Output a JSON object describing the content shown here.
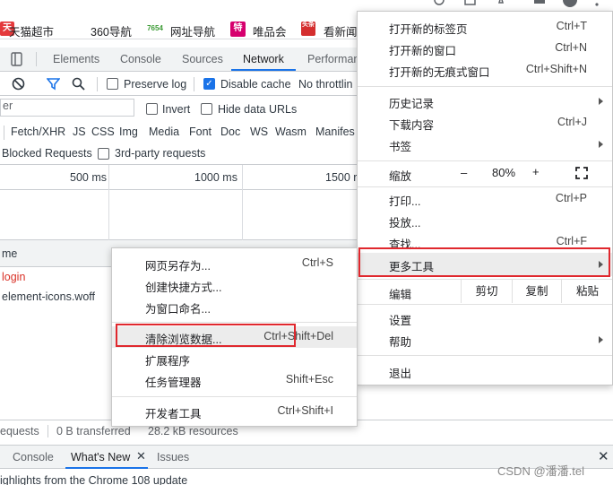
{
  "bookmarks": [
    {
      "icon": "天",
      "label": "天猫超市",
      "color": "#e4393c"
    },
    {
      "icon": "",
      "label": "360导航",
      "color": "#ffffff"
    },
    {
      "icon": "7654",
      "label": "网址导航",
      "color": "#ffffff"
    },
    {
      "icon": "特",
      "label": "唯品会",
      "color": "#d6006e"
    },
    {
      "icon": "头条",
      "label": "看新闻",
      "color": "#d42e2e"
    }
  ],
  "devtools": {
    "tabs": [
      "Elements",
      "Console",
      "Sources",
      "Network",
      "Performan"
    ],
    "active_tab": "Network",
    "preserve_log": "Preserve log",
    "disable_cache": "Disable cache",
    "throttling": "No throttlin",
    "filter_value": "er",
    "invert": "Invert",
    "hide_data_urls": "Hide data URLs",
    "types": [
      "Fetch/XHR",
      "JS",
      "CSS",
      "Img",
      "Media",
      "Font",
      "Doc",
      "WS",
      "Wasm",
      "Manifes"
    ],
    "blocked_requests": "Blocked Requests",
    "third_party": "3rd-party requests",
    "ticks": [
      "500 ms",
      "1000 ms",
      "1500 r"
    ],
    "name_header": "me",
    "requests": [
      {
        "name": "login",
        "color": "#d93025"
      },
      {
        "name": "element-icons.woff",
        "color": "#303942"
      }
    ],
    "status": [
      "equests",
      "0 B transferred",
      "28.2 kB resources"
    ],
    "drawer_tabs": [
      "Console",
      "What's New",
      "Issues"
    ],
    "drawer_text": "ighlights from the Chrome 108 update"
  },
  "context_menu": {
    "items": [
      {
        "label": "网页另存为...",
        "shortcut": "Ctrl+S"
      },
      {
        "label": "创建快捷方式...",
        "shortcut": ""
      },
      {
        "label": "为窗口命名...",
        "shortcut": ""
      },
      {
        "label": "清除浏览数据...",
        "shortcut": "Ctrl+Shift+Del"
      },
      {
        "label": "扩展程序",
        "shortcut": ""
      },
      {
        "label": "任务管理器",
        "shortcut": "Shift+Esc"
      },
      {
        "label": "开发者工具",
        "shortcut": "Ctrl+Shift+I"
      }
    ]
  },
  "chrome_menu": {
    "new_tab": {
      "label": "打开新的标签页",
      "shortcut": "Ctrl+T"
    },
    "new_window": {
      "label": "打开新的窗口",
      "shortcut": "Ctrl+N"
    },
    "incognito": {
      "label": "打开新的无痕式窗口",
      "shortcut": "Ctrl+Shift+N"
    },
    "history": {
      "label": "历史记录"
    },
    "downloads": {
      "label": "下载内容",
      "shortcut": "Ctrl+J"
    },
    "bookmarks": {
      "label": "书签"
    },
    "zoom": {
      "label": "缩放",
      "minus": "–",
      "value": "80%",
      "plus": "+"
    },
    "print": {
      "label": "打印...",
      "shortcut": "Ctrl+P"
    },
    "cast": {
      "label": "投放..."
    },
    "find": {
      "label": "查找...",
      "shortcut": "Ctrl+F"
    },
    "more_tools": {
      "label": "更多工具"
    },
    "edit": {
      "label": "编辑",
      "cut": "剪切",
      "copy": "复制",
      "paste": "粘贴"
    },
    "settings": {
      "label": "设置"
    },
    "help": {
      "label": "帮助"
    },
    "exit": {
      "label": "退出"
    }
  },
  "watermark": "CSDN @潘潘.tel"
}
